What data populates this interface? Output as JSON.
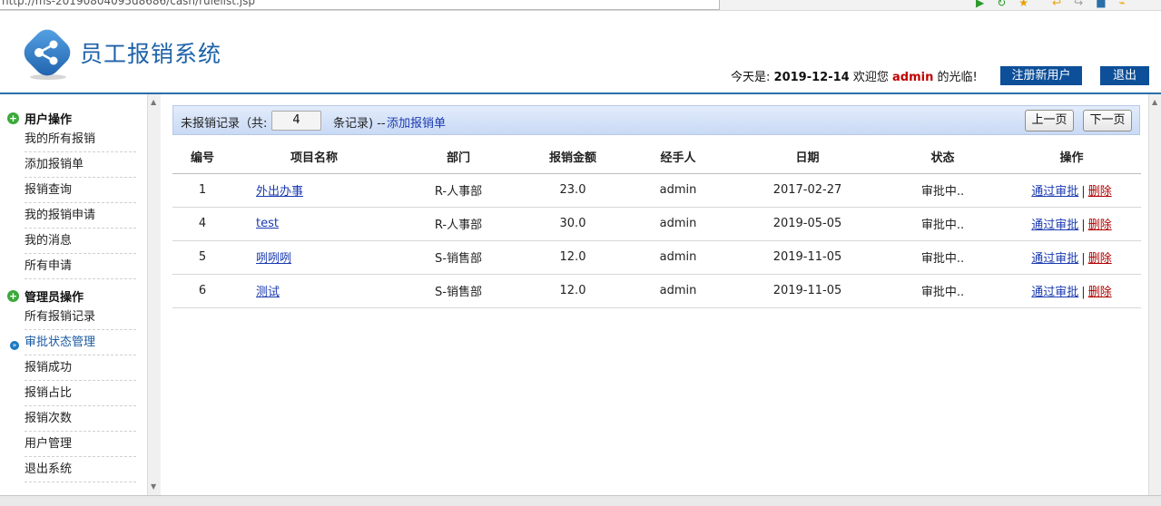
{
  "browser": {
    "address_text": "http://ms-20190804095d8686/cash/rulelist.jsp"
  },
  "header": {
    "title": "员工报销系统",
    "today_label": "今天是:",
    "date": "2019-12-14",
    "welcome_prefix": "欢迎您",
    "username": "admin",
    "welcome_suffix": "的光临!",
    "register_button": "注册新用户",
    "logout_button": "退出"
  },
  "sidebar": {
    "groups": [
      {
        "title": "用户操作",
        "items": [
          "我的所有报销",
          "添加报销单",
          "报销查询",
          "我的报销申请",
          "我的消息",
          "所有申请"
        ]
      },
      {
        "title": "管理员操作",
        "items": [
          "所有报销记录",
          "审批状态管理",
          "报销成功",
          "报销占比",
          "报销次数",
          "用户管理",
          "退出系统"
        ]
      }
    ],
    "active_item": "审批状态管理"
  },
  "toolbar": {
    "prefix": "未报销记录（共:",
    "count": "4",
    "suffix": "条记录) --",
    "add_link": "添加报销单",
    "prev_button": "上一页",
    "next_button": "下一页"
  },
  "table": {
    "headers": [
      "编号",
      "项目名称",
      "部门",
      "报销金额",
      "经手人",
      "日期",
      "状态",
      "操作"
    ],
    "rows": [
      {
        "id": "1",
        "name": "外出办事",
        "dept": "R-人事部",
        "amount": "23.0",
        "handler": "admin",
        "date": "2017-02-27",
        "status": "审批中..",
        "approve": "通过审批",
        "delete": "删除"
      },
      {
        "id": "4",
        "name": "test",
        "dept": "R-人事部",
        "amount": "30.0",
        "handler": "admin",
        "date": "2019-05-05",
        "status": "审批中..",
        "approve": "通过审批",
        "delete": "删除"
      },
      {
        "id": "5",
        "name": "咧咧咧",
        "dept": "S-销售部",
        "amount": "12.0",
        "handler": "admin",
        "date": "2019-11-05",
        "status": "审批中..",
        "approve": "通过审批",
        "delete": "删除"
      },
      {
        "id": "6",
        "name": "测试",
        "dept": "S-销售部",
        "amount": "12.0",
        "handler": "admin",
        "date": "2019-11-05",
        "status": "审批中..",
        "approve": "通过审批",
        "delete": "删除"
      }
    ],
    "separator": "|"
  },
  "colors": {
    "brand": "#1d62a8",
    "header_button": "#0d4f99",
    "username": "#c00000",
    "link": "#1a3ab0",
    "delete_link": "#b00000"
  }
}
